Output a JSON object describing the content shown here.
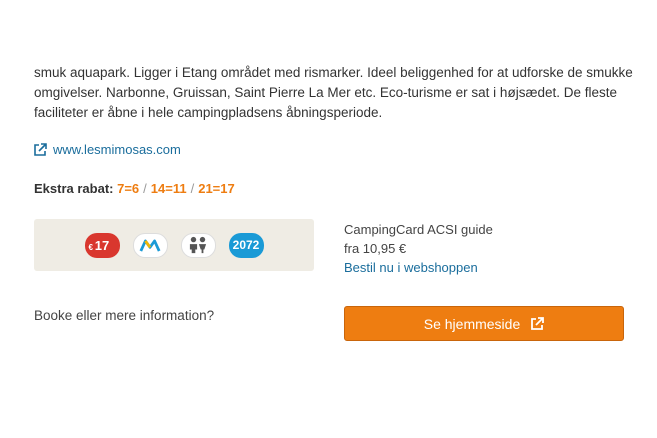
{
  "description": "smuk aquapark. Ligger i Etang området med rismarker. Ideel beliggenhed for at udforske de smukke omgivelser. Narbonne, Gruissan, Saint Pierre La Mer etc. Eco-turisme er sat i højsædet. De fleste faciliteter er åbne i hele campingpladsens åbningsperiode.",
  "website": {
    "url_text": "www.lesmimosas.com",
    "icon": "external-link-icon"
  },
  "discount": {
    "label": "Ekstra rabat:",
    "items": [
      "7=6",
      "14=11",
      "21=17"
    ],
    "separator": "/"
  },
  "badges": [
    {
      "name": "euro-17-badge",
      "prefix": "€",
      "text": "17",
      "color": "#d9372e"
    },
    {
      "name": "acsi-logo-badge",
      "text": "",
      "color": "#ffffff"
    },
    {
      "name": "children-badge",
      "text": "",
      "color": "#ffffff"
    },
    {
      "name": "campsite-number-badge",
      "text": "2072",
      "color": "#1a9ad6"
    }
  ],
  "guide": {
    "title": "CampingCard ACSI guide",
    "price": "fra 10,95 €",
    "shop_link": "Bestil nu i webshoppen"
  },
  "booking": {
    "question": "Booke eller mere information?",
    "button_label": "Se hjemmeside",
    "button_color": "#ee7d11"
  }
}
